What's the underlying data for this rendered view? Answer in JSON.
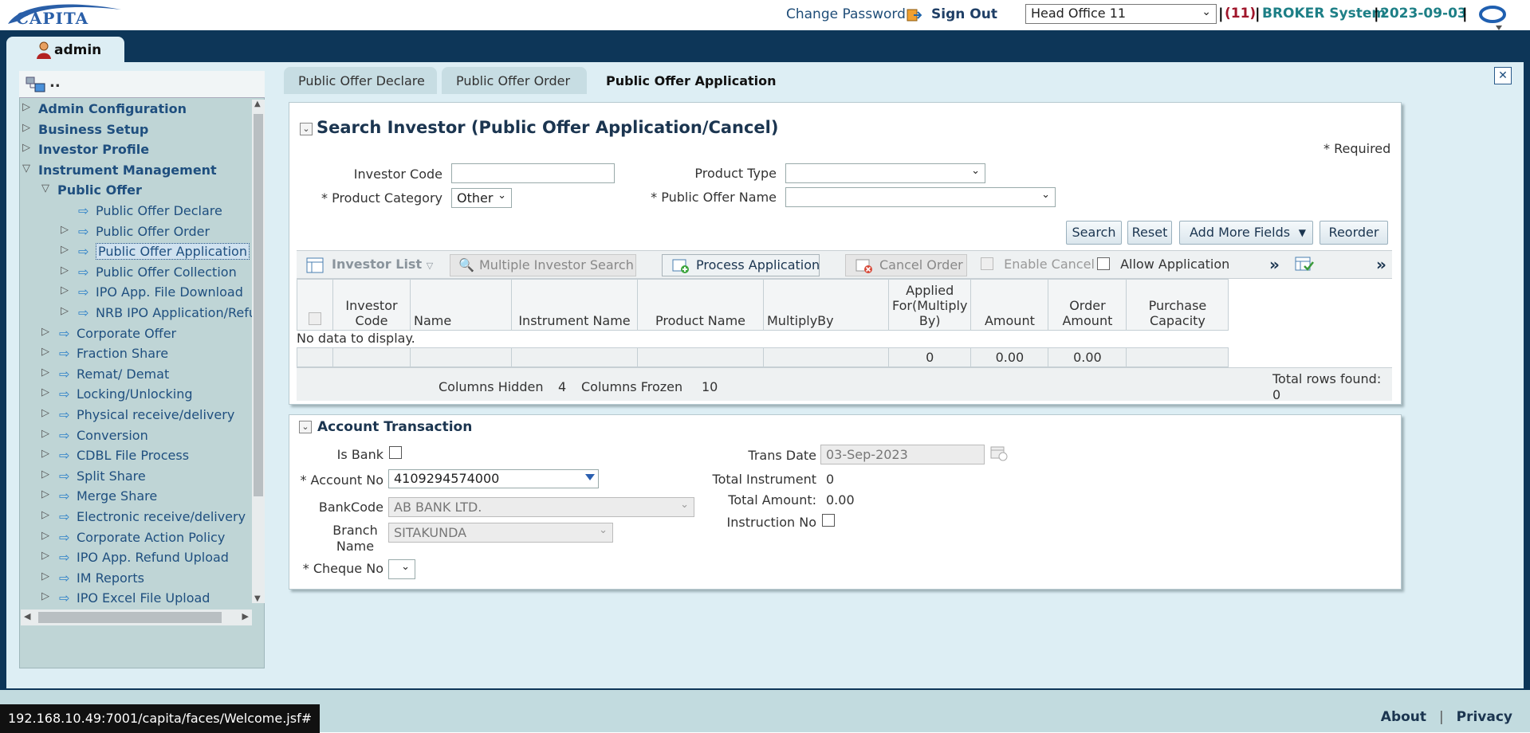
{
  "header": {
    "logo_text": "CAPITA",
    "change_password": "Change Password",
    "sign_out": "Sign Out",
    "office_selected": "Head Office 11",
    "count": "(11)",
    "system_name": "BROKER System",
    "date": "2023-09-03",
    "separator": "|"
  },
  "user": {
    "name": "admin"
  },
  "tree": {
    "header": "..",
    "items": [
      {
        "label": "Admin Configuration",
        "level": 0,
        "state": "collapsed"
      },
      {
        "label": "Business Setup",
        "level": 0,
        "state": "collapsed"
      },
      {
        "label": "Investor Profile",
        "level": 0,
        "state": "collapsed"
      },
      {
        "label": "Instrument Management",
        "level": 0,
        "state": "expanded"
      },
      {
        "label": "Public Offer",
        "level": 1,
        "state": "expanded"
      },
      {
        "label": "Public Offer Declare",
        "level": 2
      },
      {
        "label": "Public Offer Order",
        "level": 2
      },
      {
        "label": "Public Offer Application",
        "level": 2,
        "selected": true
      },
      {
        "label": "Public Offer Collection",
        "level": 2
      },
      {
        "label": "IPO App. File Download",
        "level": 2
      },
      {
        "label": "NRB IPO Application/Refun",
        "level": 2
      },
      {
        "label": "Corporate Offer",
        "level": 1
      },
      {
        "label": "Fraction Share",
        "level": 1
      },
      {
        "label": "Remat/ Demat",
        "level": 1
      },
      {
        "label": "Locking/Unlocking",
        "level": 1
      },
      {
        "label": "Physical receive/delivery",
        "level": 1
      },
      {
        "label": "Conversion",
        "level": 1
      },
      {
        "label": "CDBL File Process",
        "level": 1
      },
      {
        "label": "Split Share",
        "level": 1
      },
      {
        "label": "Merge Share",
        "level": 1
      },
      {
        "label": "Electronic receive/delivery",
        "level": 1
      },
      {
        "label": "Corporate Action Policy",
        "level": 1
      },
      {
        "label": "IPO App. Refund Upload",
        "level": 1
      },
      {
        "label": "IM Reports",
        "level": 1
      },
      {
        "label": "IPO Excel File Upload",
        "level": 1
      }
    ]
  },
  "tabs": [
    {
      "label": "Public Offer Declare"
    },
    {
      "label": "Public Offer Order"
    },
    {
      "label": "Public Offer Application",
      "active": true
    }
  ],
  "close_label": "✕",
  "search": {
    "title": "Search Investor (Public Offer Application/Cancel)",
    "required_note": "*  Required",
    "investor_code_label": "Investor Code",
    "investor_code_value": "",
    "product_category_label": "* Product Category",
    "product_category_value": "Other",
    "product_type_label": "Product Type",
    "product_type_value": "",
    "public_offer_name_label": "* Public Offer Name",
    "public_offer_name_value": "",
    "buttons": {
      "search": "Search",
      "reset": "Reset",
      "add_more": "Add More Fields",
      "reorder": "Reorder"
    }
  },
  "toolbar": {
    "investor_list": "Investor List",
    "multiple_search": "Multiple Investor Search",
    "process_application": "Process Application",
    "cancel_order": "Cancel Order",
    "enable_cancel": "Enable Cancel",
    "allow_application": "Allow Application",
    "more": "»"
  },
  "grid": {
    "columns": [
      "Investor Code",
      "Name",
      "Instrument Name",
      "Product Name",
      "MultiplyBy",
      "Applied For(Multiply By)",
      "Amount",
      "Order Amount",
      "Purchase Capacity"
    ],
    "no_data": "No data to display.",
    "totals": [
      "",
      "",
      "",
      "",
      "",
      "",
      "0",
      "0.00",
      "0.00",
      ""
    ],
    "columns_hidden_label": "Columns Hidden",
    "columns_hidden": "4",
    "columns_frozen_label": "Columns Frozen",
    "columns_frozen": "10",
    "total_rows_label": "Total rows found:",
    "total_rows": "0"
  },
  "account": {
    "title": "Account Transaction",
    "is_bank_label": "Is Bank",
    "account_no_label": "* Account No",
    "account_no_value": "4109294574000",
    "bank_code_label": "BankCode",
    "bank_code_value": "AB BANK LTD.",
    "branch_name_label": "Branch Name",
    "branch_name_value": "SITAKUNDA",
    "cheque_no_label": "* Cheque No",
    "trans_date_label": "Trans Date",
    "trans_date_value": "03-Sep-2023",
    "total_instrument_label": "Total Instrument",
    "total_instrument_value": "0",
    "total_amount_label": "Total Amount:",
    "total_amount_value": "0.00",
    "instruction_no_label": "Instruction No"
  },
  "status": {
    "url": "192.168.10.49:7001/capita/faces/Welcome.jsf#"
  },
  "footer": {
    "about": "About",
    "privacy": "Privacy"
  }
}
